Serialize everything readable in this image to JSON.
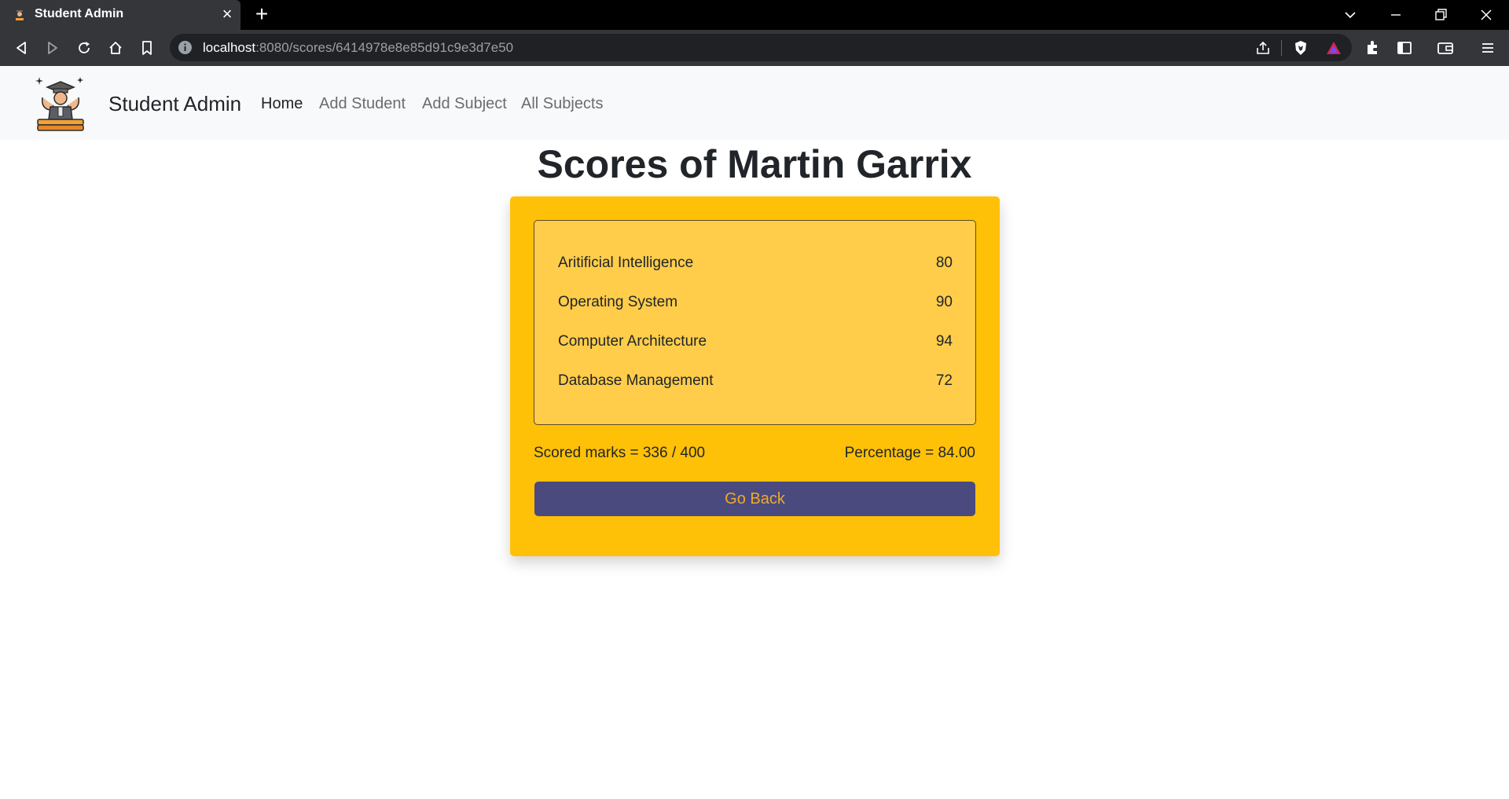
{
  "browser": {
    "tab_title": "Student Admin",
    "tab_close": "×",
    "new_tab": "+",
    "url_host": "localhost",
    "url_rest": ":8080/scores/6414978e8e85d91c9e3d7e50"
  },
  "navbar": {
    "brand": "Student Admin",
    "links": [
      {
        "label": "Home",
        "active": true
      },
      {
        "label": "Add Student",
        "active": false
      },
      {
        "label": "Add Subject",
        "active": false
      },
      {
        "label": "All Subjects",
        "active": false
      }
    ]
  },
  "page": {
    "title": "Scores of Martin Garrix",
    "scores": [
      {
        "subject": "Aritificial Intelligence",
        "score": "80"
      },
      {
        "subject": "Operating System",
        "score": "90"
      },
      {
        "subject": "Computer Architecture",
        "score": "94"
      },
      {
        "subject": "Database Management",
        "score": "72"
      }
    ],
    "scored_marks": "Scored marks = 336 / 400",
    "percentage": "Percentage = 84.00",
    "go_back_label": "Go Back"
  },
  "colors": {
    "card": "#ffc107",
    "list_bg": "#ffcd4a",
    "button_bg": "#4a4a7f",
    "button_text": "#f0a928",
    "navbar_bg": "#f8f9fa"
  }
}
